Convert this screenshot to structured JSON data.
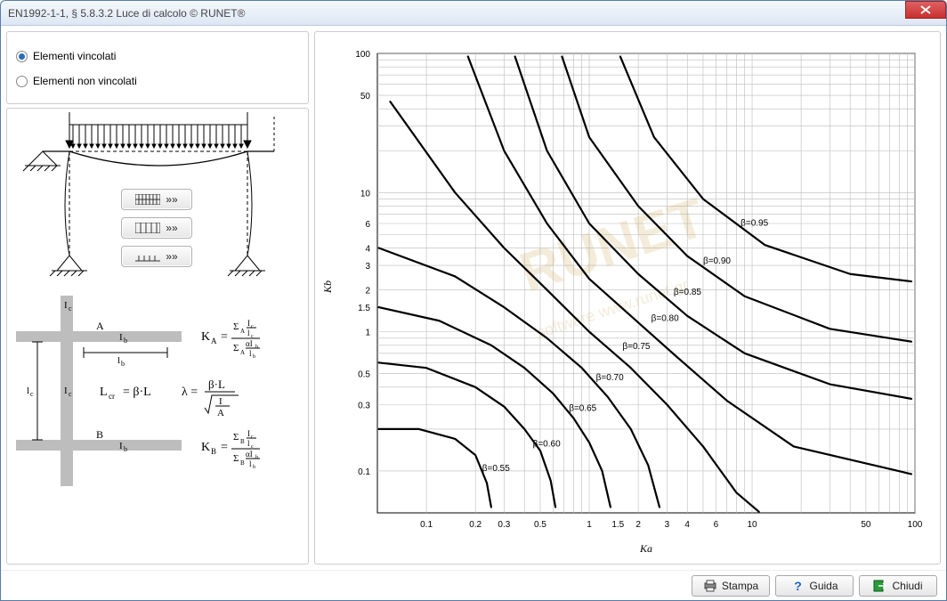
{
  "window": {
    "title": "EN1992-1-1, § 5.8.3.2  Luce di calcolo © RUNET®"
  },
  "radios": {
    "option1": "Elementi vincolati",
    "option2": "Elementi non vincolati"
  },
  "left_buttons": {
    "btn1": "»»",
    "btn2": "»»",
    "btn3": "»»"
  },
  "diagram_labels": {
    "Ic_top": "Ic",
    "A": "A",
    "Ib_top": "Ib",
    "lb": "lb",
    "lc": "lc",
    "Ic_mid": "Ic",
    "B": "B",
    "Ib_bot": "Ib",
    "Lcr": "L",
    "Lcr_pre": "cr",
    "eq_beta_L": "= β·L",
    "KA": "K",
    "KA_sub": "A",
    "KB": "K",
    "KB_sub": "B",
    "lambda": "λ ="
  },
  "bottom": {
    "print": "Stampa",
    "help": "Guida",
    "close": "Chiudi"
  },
  "chart_data": {
    "type": "line",
    "title": "",
    "xlabel": "Ka",
    "ylabel": "Kb",
    "xlim": [
      0.05,
      100
    ],
    "ylim": [
      0.05,
      100
    ],
    "x_ticks": [
      0.1,
      0.2,
      0.3,
      0.5,
      1,
      1.5,
      2,
      3,
      4,
      6,
      10,
      50,
      100
    ],
    "y_ticks": [
      0.1,
      0.3,
      0.5,
      1,
      1.5,
      2,
      3,
      4,
      6,
      10,
      50,
      100
    ],
    "x_tick_labels": [
      "0.1",
      "0.2",
      "0.3",
      "0.5",
      "1",
      "1.5",
      "2",
      "3",
      "4",
      "6",
      "10",
      "50",
      "100"
    ],
    "y_tick_labels": [
      "0.1",
      "0.3",
      "0.5",
      "1",
      "1.5",
      "2",
      "3",
      "4",
      "6",
      "10",
      "50",
      "100"
    ],
    "watermark": "RUNET",
    "watermark_sub": "software   www.runet.gr",
    "series": [
      {
        "name": "β=0.55",
        "label_xy": [
          0.22,
          0.1
        ],
        "points": [
          [
            0.051,
            0.2
          ],
          [
            0.09,
            0.2
          ],
          [
            0.15,
            0.17
          ],
          [
            0.2,
            0.13
          ],
          [
            0.235,
            0.082
          ],
          [
            0.25,
            0.055
          ]
        ]
      },
      {
        "name": "β=0.60",
        "label_xy": [
          0.45,
          0.15
        ],
        "points": [
          [
            0.051,
            0.6
          ],
          [
            0.1,
            0.55
          ],
          [
            0.2,
            0.4
          ],
          [
            0.3,
            0.29
          ],
          [
            0.4,
            0.2
          ],
          [
            0.5,
            0.14
          ],
          [
            0.58,
            0.085
          ],
          [
            0.62,
            0.055
          ]
        ]
      },
      {
        "name": "β=0.65",
        "label_xy": [
          0.75,
          0.27
        ],
        "points": [
          [
            0.051,
            1.5
          ],
          [
            0.12,
            1.2
          ],
          [
            0.25,
            0.8
          ],
          [
            0.4,
            0.55
          ],
          [
            0.6,
            0.36
          ],
          [
            0.8,
            0.24
          ],
          [
            1.0,
            0.16
          ],
          [
            1.2,
            0.1
          ],
          [
            1.35,
            0.055
          ]
        ]
      },
      {
        "name": "β=0.70",
        "label_xy": [
          1.1,
          0.45
        ],
        "points": [
          [
            0.051,
            4.0
          ],
          [
            0.15,
            2.5
          ],
          [
            0.3,
            1.5
          ],
          [
            0.55,
            0.9
          ],
          [
            0.9,
            0.55
          ],
          [
            1.3,
            0.34
          ],
          [
            1.8,
            0.2
          ],
          [
            2.3,
            0.11
          ],
          [
            2.7,
            0.055
          ]
        ]
      },
      {
        "name": "β=0.75",
        "label_xy": [
          1.6,
          0.75
        ],
        "points": [
          [
            0.06,
            45
          ],
          [
            0.15,
            10
          ],
          [
            0.3,
            4.0
          ],
          [
            0.55,
            2.0
          ],
          [
            1.0,
            1.0
          ],
          [
            1.8,
            0.55
          ],
          [
            3.0,
            0.3
          ],
          [
            5.0,
            0.15
          ],
          [
            8.0,
            0.07
          ],
          [
            11,
            0.051
          ]
        ]
      },
      {
        "name": "β=0.80",
        "label_xy": [
          2.4,
          1.2
        ],
        "points": [
          [
            0.18,
            95
          ],
          [
            0.3,
            20
          ],
          [
            0.55,
            6.0
          ],
          [
            1.0,
            2.4
          ],
          [
            1.8,
            1.3
          ],
          [
            3.5,
            0.65
          ],
          [
            7.0,
            0.32
          ],
          [
            18,
            0.15
          ],
          [
            95,
            0.095
          ]
        ]
      },
      {
        "name": "β=0.85",
        "label_xy": [
          3.3,
          1.85
        ],
        "points": [
          [
            0.35,
            95
          ],
          [
            0.55,
            20
          ],
          [
            1.0,
            6.0
          ],
          [
            2.0,
            2.6
          ],
          [
            4.0,
            1.3
          ],
          [
            9.0,
            0.7
          ],
          [
            30,
            0.42
          ],
          [
            95,
            0.33
          ]
        ]
      },
      {
        "name": "β=0.90",
        "label_xy": [
          5.0,
          3.1
        ],
        "points": [
          [
            0.68,
            95
          ],
          [
            1.0,
            25
          ],
          [
            2.0,
            8.0
          ],
          [
            4.0,
            3.5
          ],
          [
            9.0,
            1.8
          ],
          [
            30,
            1.05
          ],
          [
            95,
            0.85
          ]
        ]
      },
      {
        "name": "β=0.95",
        "label_xy": [
          8.5,
          5.8
        ],
        "points": [
          [
            1.55,
            95
          ],
          [
            2.5,
            25
          ],
          [
            5.0,
            9.0
          ],
          [
            12,
            4.2
          ],
          [
            40,
            2.6
          ],
          [
            95,
            2.3
          ]
        ]
      }
    ]
  }
}
